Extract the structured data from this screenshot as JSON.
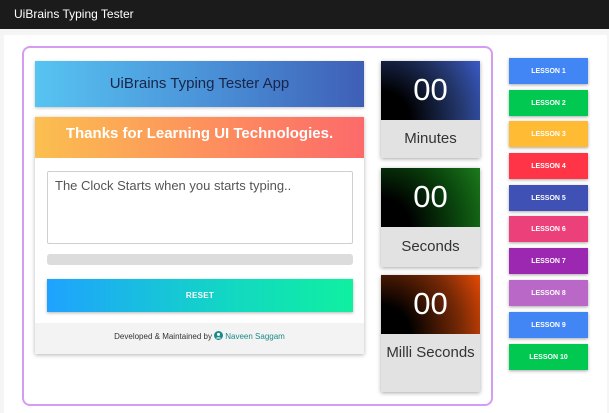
{
  "window": {
    "title": "UiBrains Typing Tester"
  },
  "app": {
    "title": "UiBrains Typing Tester App",
    "thanks_text": "Thanks for Learning UI Technologies.",
    "input_placeholder": "The Clock Starts when you starts typing..",
    "progress": 0,
    "reset_label": "RESET",
    "footer_prefix": "Developed & Maintained by",
    "footer_author": "Naveen Saggam",
    "footer_icon": "user-circle-icon"
  },
  "timers": [
    {
      "value": "00",
      "label": "Minutes"
    },
    {
      "value": "00",
      "label": "Seconds"
    },
    {
      "value": "00",
      "label": "Milli Seconds"
    }
  ],
  "lessons": [
    {
      "label": "LESSON 1",
      "color": "#4285f4"
    },
    {
      "label": "LESSON 2",
      "color": "#00c851"
    },
    {
      "label": "LESSON 3",
      "color": "#ffbb33"
    },
    {
      "label": "LESSON 4",
      "color": "#ff3547"
    },
    {
      "label": "LESSON 5",
      "color": "#3f51b5"
    },
    {
      "label": "LESSON 6",
      "color": "#ec407a"
    },
    {
      "label": "LESSON 7",
      "color": "#9c27b0"
    },
    {
      "label": "LESSON 8",
      "color": "#ba68c8"
    },
    {
      "label": "LESSON 9",
      "color": "#4285f4"
    },
    {
      "label": "LESSON 10",
      "color": "#00c851"
    }
  ]
}
